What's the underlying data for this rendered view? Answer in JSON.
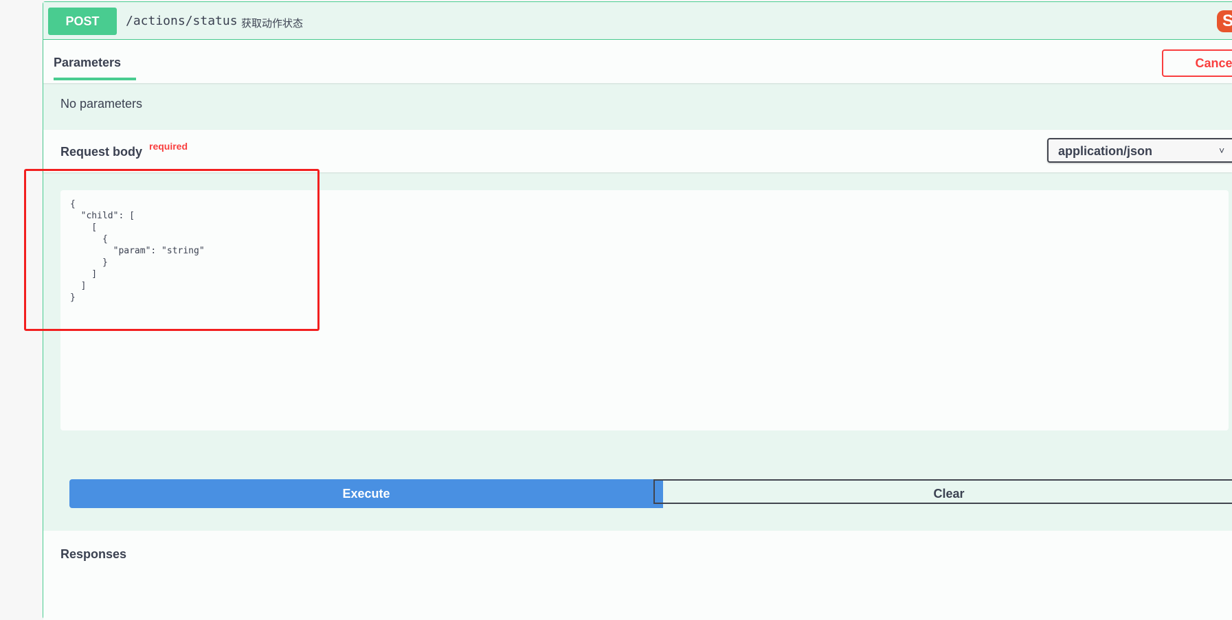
{
  "operation": {
    "method": "POST",
    "path": "/actions/status",
    "description": "获取动作状态",
    "lock_icon_glyph": "S"
  },
  "tabs": {
    "parameters_label": "Parameters",
    "cancel_label": "Cancel"
  },
  "parameters": {
    "empty_text": "No parameters"
  },
  "request_body": {
    "title": "Request body",
    "required_label": "required",
    "content_type": "application/json",
    "example": "{\n  \"child\": [\n    [\n      {\n        \"param\": \"string\"\n      }\n    ]\n  ]\n}"
  },
  "actions": {
    "execute_label": "Execute",
    "clear_label": "Clear"
  },
  "responses": {
    "title": "Responses"
  },
  "colors": {
    "post_green": "#49cc90",
    "execute_blue": "#4990e2",
    "cancel_red": "#f93e3e",
    "highlight_red": "#f21f1f"
  }
}
